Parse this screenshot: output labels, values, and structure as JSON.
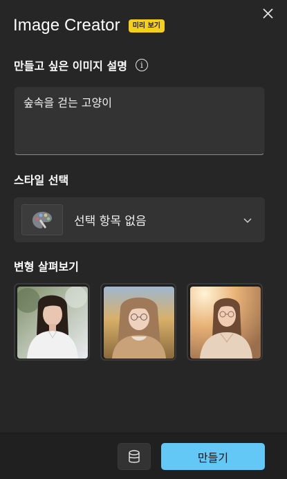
{
  "app": {
    "title": "Image Creator",
    "badge": "미리 보기"
  },
  "description": {
    "label": "만들고 싶은 이미지 설명",
    "value": "숲속을 걷는 고양이"
  },
  "style": {
    "label": "스타일 선택",
    "selected": "선택 항목 없음"
  },
  "variants": {
    "label": "변형 살펴보기",
    "items": [
      {
        "name": "variant-1"
      },
      {
        "name": "variant-2"
      },
      {
        "name": "variant-3"
      }
    ]
  },
  "footer": {
    "create_label": "만들기"
  },
  "colors": {
    "accent": "#63c8f5",
    "badge": "#f6cf1b",
    "background": "#262626"
  },
  "icons": [
    "close-icon",
    "info-icon",
    "palette-icon",
    "chevron-down-icon",
    "coins-icon"
  ]
}
